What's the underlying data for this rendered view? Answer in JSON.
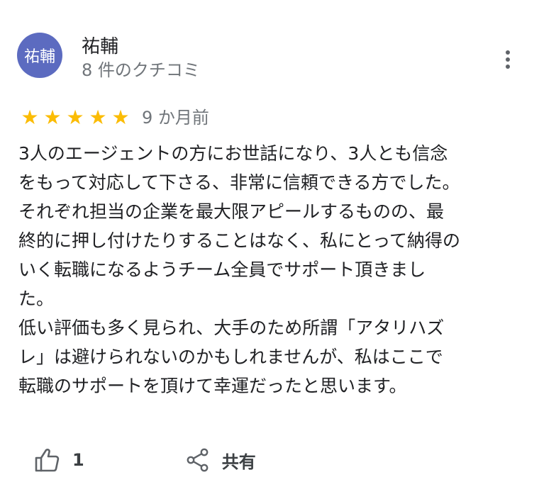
{
  "reviewer": {
    "avatar_text": "祐輔",
    "name": "祐輔",
    "review_count": "8 件のクチコミ",
    "avatar_color": "#5c6bc0"
  },
  "menu": {
    "icon": "more-vert-icon"
  },
  "rating": {
    "stars": 5,
    "max_stars": 5,
    "star_glyph": "★",
    "star_color": "#fbbc04",
    "date": "9 か月前"
  },
  "review": {
    "lines": [
      "3人のエージェントの方にお世話になり、3人とも信念",
      "をもって対応して下さる、非常に信頼できる方でした。",
      "それぞれ担当の企業を最大限アピールするものの、最",
      "終的に押し付けたりすることはなく、私にとって納得の",
      "いく転職になるようチーム全員でサポート頂きまし",
      "た。",
      "低い評価も多く見られ、大手のため所謂「アタリハズ",
      "レ」は避けられないのかもしれませんが、私はここで",
      "転職のサポートを頂けて幸運だったと思います。"
    ]
  },
  "actions": {
    "like_icon": "thumb-up-icon",
    "like_count": "1",
    "share_icon": "share-icon",
    "share_label": "共有"
  }
}
